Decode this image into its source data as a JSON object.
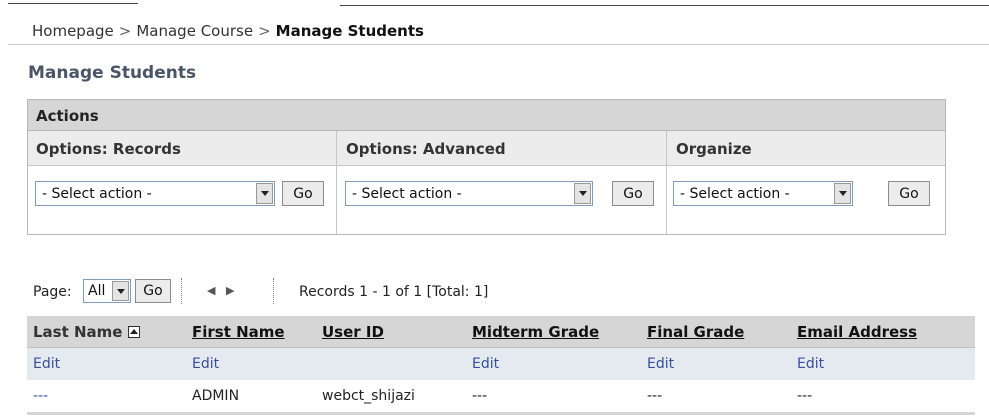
{
  "breadcrumb": {
    "items": [
      "Homepage",
      "Manage Course"
    ],
    "separator": ">",
    "current": "Manage Students"
  },
  "page_title": "Manage Students",
  "actions": {
    "title": "Actions",
    "columns": [
      {
        "label": "Options: Records",
        "select_value": "- Select action -",
        "button": "Go"
      },
      {
        "label": "Options: Advanced",
        "select_value": "- Select action -",
        "button": "Go"
      },
      {
        "label": "Organize",
        "select_value": "- Select action -",
        "button": "Go"
      }
    ]
  },
  "pager": {
    "page_label": "Page:",
    "page_select": "All",
    "go_label": "Go",
    "prev_icon": "◀",
    "next_icon": "▶",
    "records": "Records 1 - 1 of 1 [Total: 1]"
  },
  "table": {
    "columns": [
      "Last Name",
      "First Name",
      "User ID",
      "Midterm Grade",
      "Final Grade",
      "Email Address"
    ],
    "edit_row": [
      "Edit",
      "Edit",
      "",
      "Edit",
      "Edit",
      "Edit"
    ],
    "rows": [
      [
        "---",
        "ADMIN",
        "webct_shijazi",
        "---",
        "---",
        "---"
      ]
    ]
  },
  "colors": {
    "header_bg": "#d6d6d6",
    "subheader_bg": "#ececec",
    "edit_row_bg": "#e4eaf0",
    "link": "#3a4e9a",
    "title": "#4a5668"
  }
}
